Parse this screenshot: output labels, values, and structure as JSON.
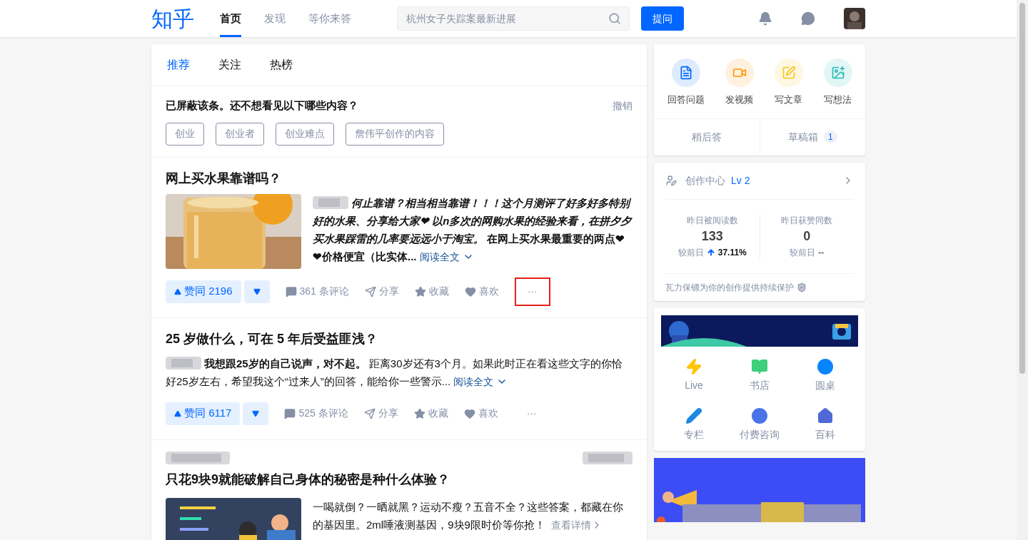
{
  "header": {
    "logo": "知乎",
    "nav": [
      {
        "label": "首页",
        "selected": true
      },
      {
        "label": "发现",
        "selected": false
      },
      {
        "label": "等你来答",
        "selected": false
      }
    ],
    "search": {
      "placeholder": "杭州女子失踪案最新进展"
    },
    "ask_button": "提问"
  },
  "feed_tabs": [
    {
      "label": "推荐",
      "selected": true
    },
    {
      "label": "关注",
      "selected": false
    },
    {
      "label": "热榜",
      "selected": false
    }
  ],
  "blocked": {
    "message": "已屏蔽该条。还不想看见以下哪些内容？",
    "undo": "撤销",
    "tags": [
      "创业",
      "创业者",
      "创业难点",
      "詹伟平创作的内容"
    ]
  },
  "feed": [
    {
      "kind": "answer",
      "title": "网上买水果靠谱吗？",
      "has_picture": true,
      "excerpt": "*何止靠谱？相当相当靠谱！！！这个月测评了好多好多特别好的水果、分享给大家❤ 以n多次的网购水果的经验来看，在拼夕夕买水果踩雷的几率要远远小于淘宝。* 在网上买水果最重要的两点❤ ❤价格便宜（比实体...",
      "read_more": "阅读全文",
      "upvote": "赞同 2196",
      "comments": "361 条评论",
      "share": "分享",
      "collect": "收藏",
      "like": "喜欢",
      "more": "···",
      "more_highlighted": true
    },
    {
      "kind": "answer",
      "title": "25 岁做什么，可在 5 年后受益匪浅？",
      "has_picture": false,
      "excerpt": "**我想跟25岁的自己说声，对不起。** 距离30岁还有3个月。如果此时正在看这些文字的你恰好25岁左右，希望我这个“过来人”的回答，能给你一些警示...",
      "read_more": "阅读全文",
      "upvote": "赞同 6117",
      "comments": "525 条评论",
      "share": "分享",
      "collect": "收藏",
      "like": "喜欢",
      "more": "···",
      "more_highlighted": false
    },
    {
      "kind": "ad",
      "title": "只花9块9就能破解自己身体的秘密是种什么体验？",
      "excerpt": "一喝就倒？一晒就黑？运动不瘦？五音不全？这些答案，都藏在你的基因里。2ml唾液测基因，9块9限时价等你抢！",
      "read_more": "查看详情"
    }
  ],
  "create_card": {
    "actions": [
      {
        "label": "回答问题",
        "color": "#0066ff"
      },
      {
        "label": "发视频",
        "color": "#ff9607"
      },
      {
        "label": "写文章",
        "color": "#f8c51c"
      },
      {
        "label": "写想法",
        "color": "#2bbcb8"
      }
    ],
    "later": "稍后答",
    "drafts": "草稿箱",
    "drafts_count": "1"
  },
  "creator_card": {
    "title": "创作中心",
    "level": "Lv 2",
    "stats": [
      {
        "label": "昨日被阅读数",
        "value": "133",
        "compare": "较前日",
        "change": "37.11%",
        "rising": true
      },
      {
        "label": "昨日获赞同数",
        "value": "0",
        "compare": "较前日",
        "change": "--",
        "rising": false
      }
    ],
    "protection": "瓦力保镖为你的创作提供持续保护"
  },
  "tools": [
    {
      "label": "Live",
      "color": "#ffc500"
    },
    {
      "label": "书店",
      "color": "#3ecf7a"
    },
    {
      "label": "圆桌",
      "color": "#0a85ff"
    },
    {
      "label": "专栏",
      "color": "#1e88e5"
    },
    {
      "label": "付费咨询",
      "color": "#4a73e8"
    },
    {
      "label": "百科",
      "color": "#5169d6"
    }
  ]
}
